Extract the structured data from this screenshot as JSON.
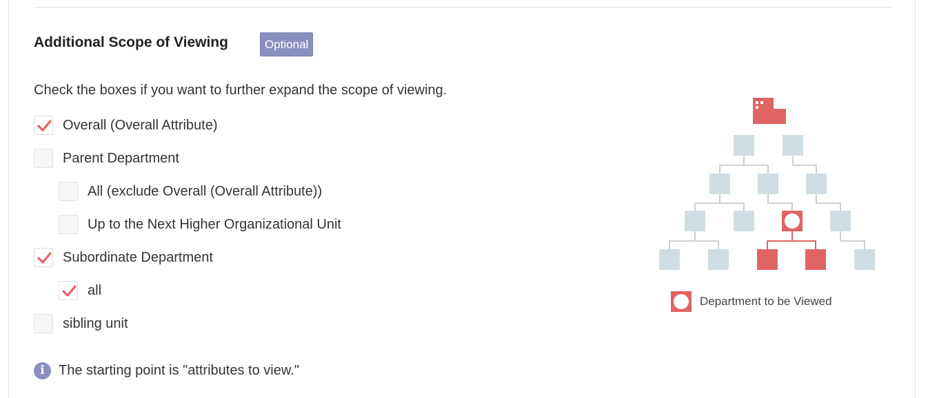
{
  "section": {
    "title": "Additional Scope of Viewing",
    "badge": "Optional",
    "description": "Check the boxes if you want to further expand the scope of viewing."
  },
  "options": [
    {
      "label": "Overall (Overall Attribute)",
      "checked": true
    },
    {
      "label": "Parent Department",
      "checked": false
    },
    {
      "label": "All (exclude Overall (Overall Attribute))",
      "checked": false
    },
    {
      "label": "Up to the Next Higher Organizational Unit",
      "checked": false
    },
    {
      "label": "Subordinate Department",
      "checked": true
    },
    {
      "label": "all",
      "checked": true
    },
    {
      "label": "sibling unit",
      "checked": false
    }
  ],
  "note": {
    "icon": "info-icon",
    "text": "The starting point is \"attributes to view.\""
  },
  "diagram": {
    "legend": "Department to be Viewed"
  },
  "colors": {
    "accent": "#e06464",
    "badge": "#8a8fbd",
    "node": "#d0dde3",
    "connector": "#cfcfcf"
  }
}
